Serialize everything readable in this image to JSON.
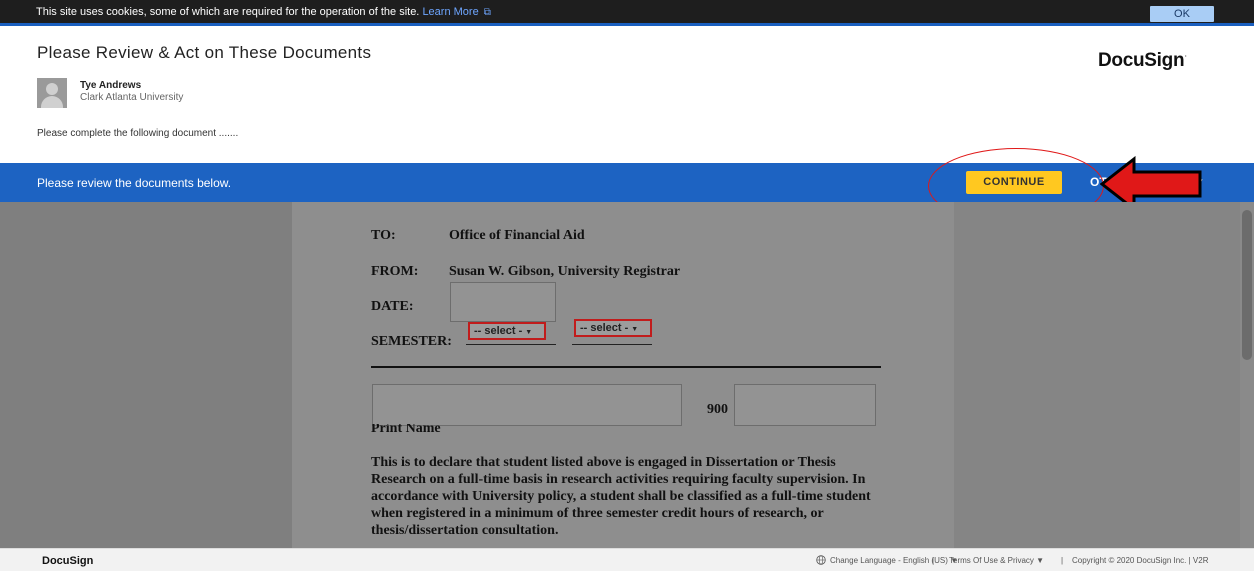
{
  "cookie_banner": {
    "text": "This site uses cookies, some of which are required for the operation of the site.",
    "link": "Learn More",
    "ok_label": "OK"
  },
  "header": {
    "title": "Please Review & Act on These Documents",
    "brand": "DocuSign",
    "sender_name": "Tye Andrews",
    "sender_org": "Clark Atlanta University",
    "message": "Please complete the following document ......."
  },
  "action_bar": {
    "text": "Please review the documents below.",
    "continue_label": "CONTINUE",
    "other_actions_label": "OTHER ACTIONS",
    "caret": "▾"
  },
  "document": {
    "to_label": "TO:",
    "to_value": "Office of Financial Aid",
    "from_label": "FROM:",
    "from_value": "Susan W. Gibson, University Registrar",
    "date_label": "DATE:",
    "semester_label": "SEMESTER:",
    "select_1": "-- select -",
    "select_2": "-- select -",
    "id_prefix": "900",
    "print_name_label": "Print Name",
    "paragraph": "This is to declare that student listed above is engaged in Dissertation or Thesis Research on a full-time basis in research activities requiring faculty supervision.  In accordance with University policy, a student shall be classified as a full-time student when registered in a minimum of three semester credit hours of research, or thesis/dissertation consultation."
  },
  "footer": {
    "brand": "DocuSign",
    "language": "Change Language - English (US)",
    "terms": "Terms Of Use & Privacy",
    "copyright": "Copyright © 2020 DocuSign Inc. | V2R",
    "separator": "|",
    "caret": "▼"
  },
  "colors": {
    "action_bar": "#1d63c2",
    "continue_button": "#ffc820",
    "annotation_red": "#e01818"
  },
  "icons": [
    "external-link-icon",
    "avatar-icon",
    "globe-icon",
    "chevron-down-icon",
    "red-arrow-annotation"
  ]
}
